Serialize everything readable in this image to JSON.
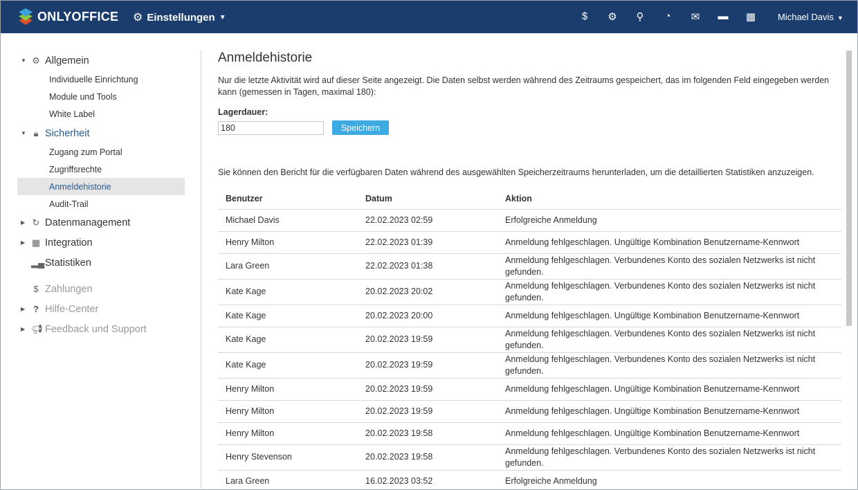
{
  "header": {
    "logo": "ONLYOFFICE",
    "module": "Einstellungen",
    "user": "Michael Davis",
    "icons": [
      "payments-icon",
      "settings-icon",
      "search-icon",
      "feed-icon",
      "mail-icon",
      "chat-icon",
      "calendar-icon"
    ]
  },
  "sidebar": {
    "allgemein": "Allgemein",
    "allgemein_items": [
      "Individuelle Einrichtung",
      "Module und Tools",
      "White Label"
    ],
    "sicherheit": "Sicherheit",
    "sicherheit_items": [
      "Zugang zum Portal",
      "Zugriffsrechte",
      "Anmeldehistorie",
      "Audit-Trail"
    ],
    "datenmanagement": "Datenmanagement",
    "integration": "Integration",
    "statistiken": "Statistiken",
    "zahlungen": "Zahlungen",
    "hilfe": "Hilfe-Center",
    "feedback": "Feedback und Support"
  },
  "main": {
    "title": "Anmeldehistorie",
    "description": "Nur die letzte Aktivität wird auf dieser Seite angezeigt. Die Daten selbst werden während des Zeitraums gespeichert, das im folgenden Feld eingegeben werden kann (gemessen in Tagen, maximal 180):",
    "storage_label": "Lagerdauer:",
    "storage_value": "180",
    "save_button": "Speichern",
    "report_text": "Sie können den Bericht für die verfügbaren Daten während des ausgewählten Speicherzeitraums herunterladen, um die detaillierten Statistiken anzuzeigen.",
    "table": {
      "headers": [
        "Benutzer",
        "Datum",
        "Aktion"
      ],
      "rows": [
        [
          "Michael Davis",
          "22.02.2023 02:59",
          "Erfolgreiche Anmeldung"
        ],
        [
          "Henry Milton",
          "22.02.2023 01:39",
          "Anmeldung fehlgeschlagen. Ungültige Kombination Benutzername-Kennwort"
        ],
        [
          "Lara Green",
          "22.02.2023 01:38",
          "Anmeldung fehlgeschlagen. Verbundenes Konto des sozialen Netzwerks ist nicht gefunden."
        ],
        [
          "Kate Kage",
          "20.02.2023 20:02",
          "Anmeldung fehlgeschlagen. Verbundenes Konto des sozialen Netzwerks ist nicht gefunden."
        ],
        [
          "Kate Kage",
          "20.02.2023 20:00",
          "Anmeldung fehlgeschlagen. Ungültige Kombination Benutzername-Kennwort"
        ],
        [
          "Kate Kage",
          "20.02.2023 19:59",
          "Anmeldung fehlgeschlagen. Verbundenes Konto des sozialen Netzwerks ist nicht gefunden."
        ],
        [
          "Kate Kage",
          "20.02.2023 19:59",
          "Anmeldung fehlgeschlagen. Verbundenes Konto des sozialen Netzwerks ist nicht gefunden."
        ],
        [
          "Henry Milton",
          "20.02.2023 19:59",
          "Anmeldung fehlgeschlagen. Ungültige Kombination Benutzername-Kennwort"
        ],
        [
          "Henry Milton",
          "20.02.2023 19:59",
          "Anmeldung fehlgeschlagen. Ungültige Kombination Benutzername-Kennwort"
        ],
        [
          "Henry Milton",
          "20.02.2023 19:58",
          "Anmeldung fehlgeschlagen. Ungültige Kombination Benutzername-Kennwort"
        ],
        [
          "Henry Stevenson",
          "20.02.2023 19:58",
          "Anmeldung fehlgeschlagen. Verbundenes Konto des sozialen Netzwerks ist nicht gefunden."
        ],
        [
          "Lara Green",
          "16.02.2023 03:52",
          "Erfolgreiche Anmeldung"
        ]
      ]
    }
  }
}
